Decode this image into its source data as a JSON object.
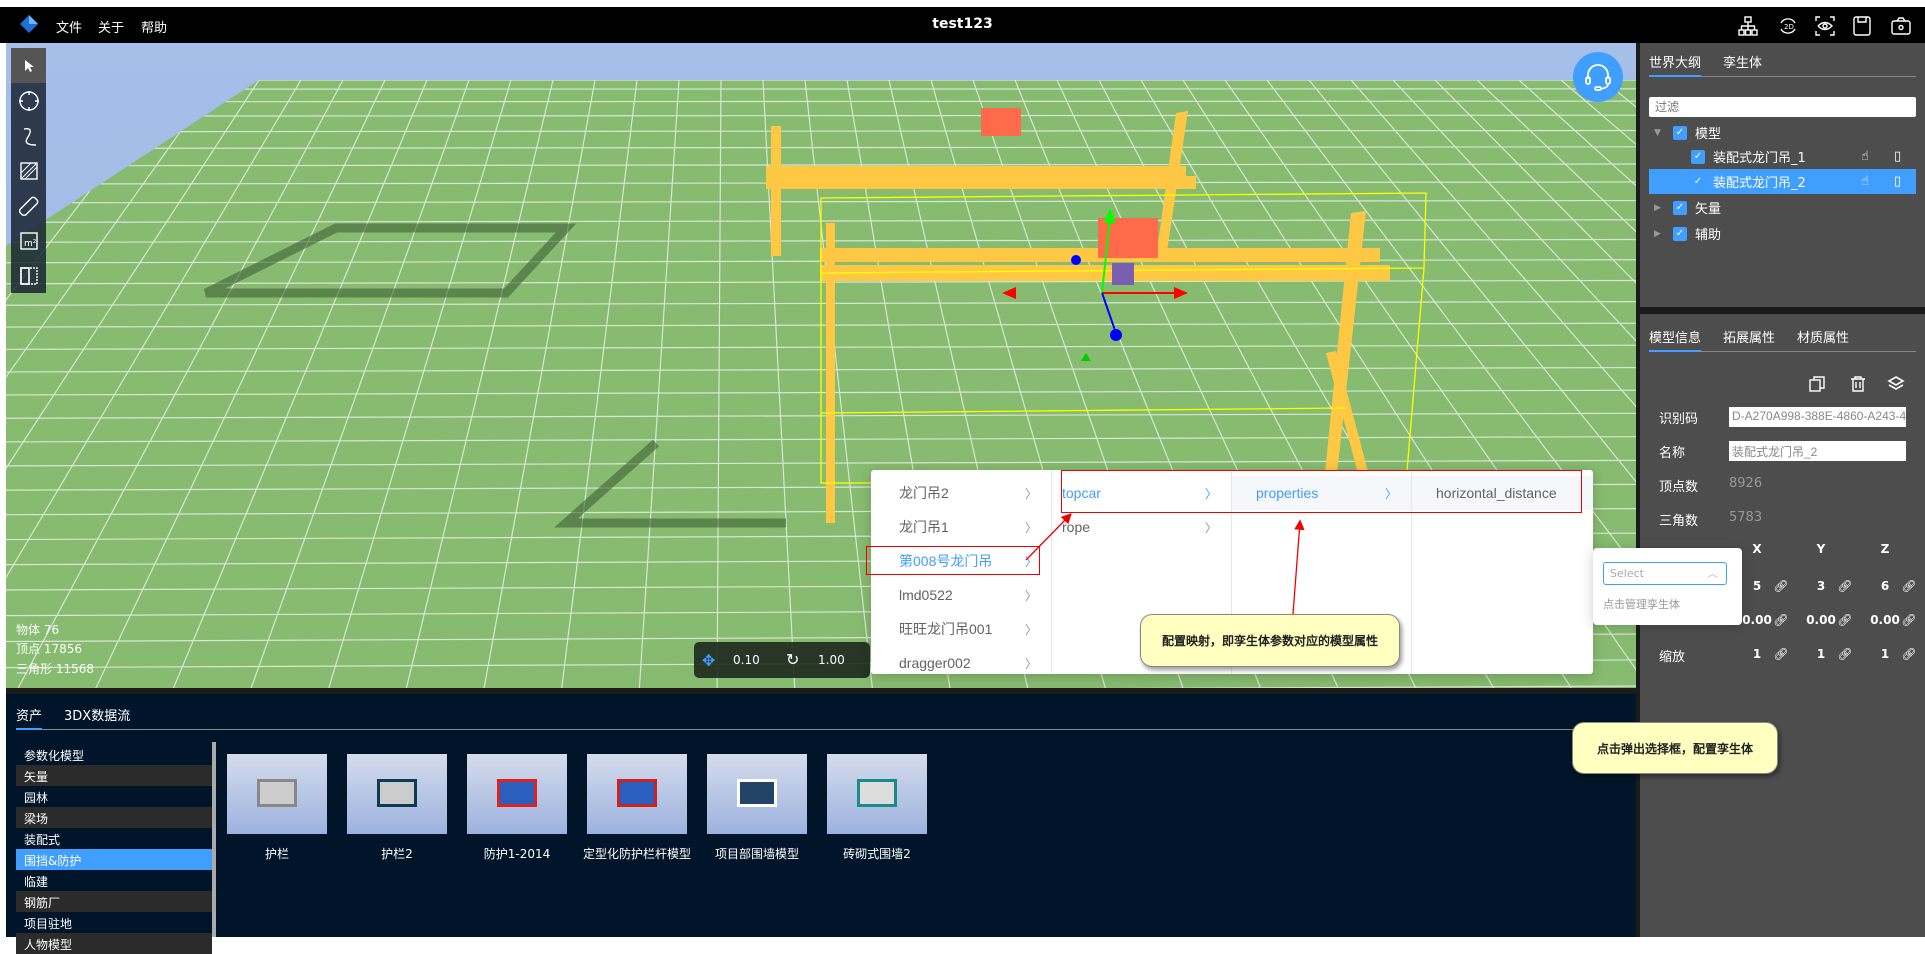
{
  "app": {
    "title": "test123",
    "menu": [
      "文件",
      "关于",
      "帮助"
    ],
    "toolbar_icons": [
      "hierarchy-icon",
      "2d-rotate-icon",
      "eye-focus-icon",
      "save-icon",
      "camera-icon"
    ]
  },
  "viewport": {
    "left_tools": [
      "pointer-icon",
      "crosshair-icon",
      "curve-icon",
      "area-icon",
      "ruler-icon",
      "area-measure-icon",
      "split-view-icon"
    ],
    "stats": [
      "物体 76",
      "顶点 17856",
      "三角形 11568"
    ],
    "transform": {
      "move": "0.10",
      "rotate": "1.00"
    }
  },
  "cascader": {
    "col1": [
      "龙门吊2",
      "龙门吊1",
      "第008号龙门吊",
      "lmd0522",
      "旺旺龙门吊001",
      "dragger002"
    ],
    "col2": [
      "topcar",
      "rope"
    ],
    "col3": [
      "properties"
    ],
    "col4": [
      "horizontal_distance"
    ]
  },
  "callouts": {
    "mapping": "配置映射，即孪生体参数对应的模型属性",
    "select": "点击弹出选择框，配置孪生体"
  },
  "popover": {
    "placeholder": "Select",
    "hint": "点击管理孪生体"
  },
  "outline": {
    "tabs": [
      "世界大纲",
      "孪生体"
    ],
    "filter_placeholder": "过滤",
    "tree": [
      {
        "label": "模型",
        "expanded": true
      },
      {
        "label": "装配式龙门吊_1",
        "child": true
      },
      {
        "label": "装配式龙门吊_2",
        "child": true,
        "selected": true
      },
      {
        "label": "矢量"
      },
      {
        "label": "辅助"
      }
    ]
  },
  "props": {
    "tabs": [
      "模型信息",
      "拓展属性",
      "材质属性"
    ],
    "id_label": "识别码",
    "id_value": "D-A270A998-388E-4860-A243-4",
    "name_label": "名称",
    "name_value": "装配式龙门吊_2",
    "verts_label": "顶点数",
    "verts": "8926",
    "tris_label": "三角数",
    "tris": "5783",
    "axes": [
      "X",
      "Y",
      "Z"
    ],
    "position": [
      "5",
      "3",
      "6"
    ],
    "rotation": [
      "0.00",
      "0.00",
      "0.00"
    ],
    "scale_label": "缩放",
    "scale": [
      "1",
      "1",
      "1"
    ]
  },
  "assets": {
    "tabs": [
      "资产",
      "3DX数据流"
    ],
    "categories": [
      "参数化模型",
      "矢量",
      "园林",
      "梁场",
      "装配式",
      "围挡&防护",
      "临建",
      "钢筋厂",
      "项目驻地",
      "人物模型"
    ],
    "selected_category": "围挡&防护",
    "items": [
      "护栏",
      "护栏2",
      "防护1-2014",
      "定型化防护栏杆模型",
      "项目部围墙模型",
      "砖砌式围墙2"
    ]
  },
  "colors": {
    "accent": "#409eff",
    "ground": "#87bb70",
    "crane": "#ffc844"
  }
}
